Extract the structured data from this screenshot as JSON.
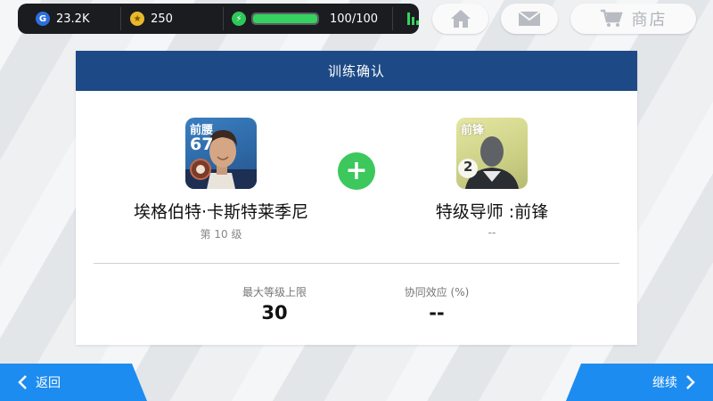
{
  "topbar": {
    "gp": {
      "icon": "gp-coin-icon",
      "letter": "G",
      "value": "23.2K"
    },
    "coins": {
      "icon": "star-coin-icon",
      "value": "250"
    },
    "energy": {
      "icon": "lightning-icon",
      "value": "100/100",
      "fill_fraction": 1.0
    },
    "stats_icon": "bar-chart-icon"
  },
  "nav": {
    "home_icon": "home-icon",
    "mail_icon": "mail-icon",
    "shop": {
      "icon": "cart-icon",
      "label": "商店"
    }
  },
  "dialog": {
    "title": "训练确认",
    "left_player": {
      "position": "前腰",
      "rating": "67",
      "name": "埃格伯特·卡斯特莱季尼",
      "level": "第 10 级"
    },
    "plus_icon": "plus-icon",
    "right_player": {
      "position": "前锋",
      "badge_number": "2",
      "name": "特级导师 :前锋",
      "level": "--"
    },
    "stats": [
      {
        "label": "最大等级上限",
        "value": "30"
      },
      {
        "label": "协同效应 (%)",
        "value": "--"
      }
    ]
  },
  "footer": {
    "back_label": "返回",
    "continue_label": "继续"
  },
  "colors": {
    "header": "#1d4a86",
    "accent_blue": "#1d8cf0",
    "energy_green": "#35d260",
    "plus_green": "#3cc85c"
  }
}
